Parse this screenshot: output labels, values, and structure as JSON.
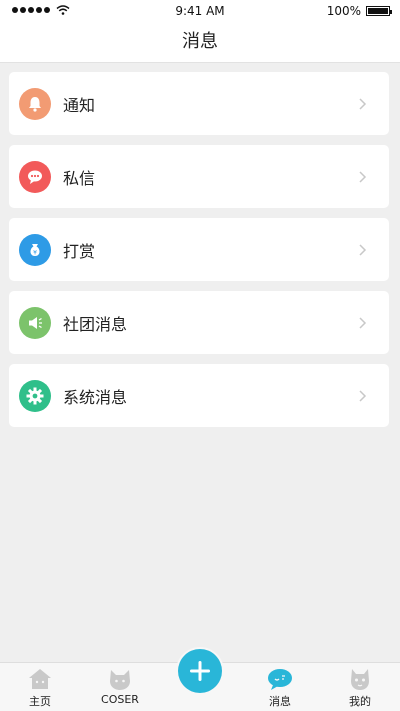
{
  "status_bar": {
    "time": "9:41 AM",
    "battery": "100%"
  },
  "header": {
    "title": "消息"
  },
  "messages": [
    {
      "label": "通知",
      "icon": "bell-icon",
      "color": "#f29b73"
    },
    {
      "label": "私信",
      "icon": "chat-bubble-icon",
      "color": "#f25a5a"
    },
    {
      "label": "打赏",
      "icon": "money-bag-icon",
      "color": "#2e9be6"
    },
    {
      "label": "社团消息",
      "icon": "megaphone-icon",
      "color": "#7cc36b"
    },
    {
      "label": "系统消息",
      "icon": "gear-icon",
      "color": "#2fbf8a"
    }
  ],
  "tabs": [
    {
      "label": "主页",
      "icon": "house-icon"
    },
    {
      "label": "COSER",
      "icon": "cat-icon"
    },
    {
      "label": "",
      "icon": "plus-icon"
    },
    {
      "label": "消息",
      "icon": "chat-bubble-icon"
    },
    {
      "label": "我的",
      "icon": "cat-face-icon"
    }
  ],
  "colors": {
    "accent": "#29b6d8",
    "background": "#efefef"
  }
}
